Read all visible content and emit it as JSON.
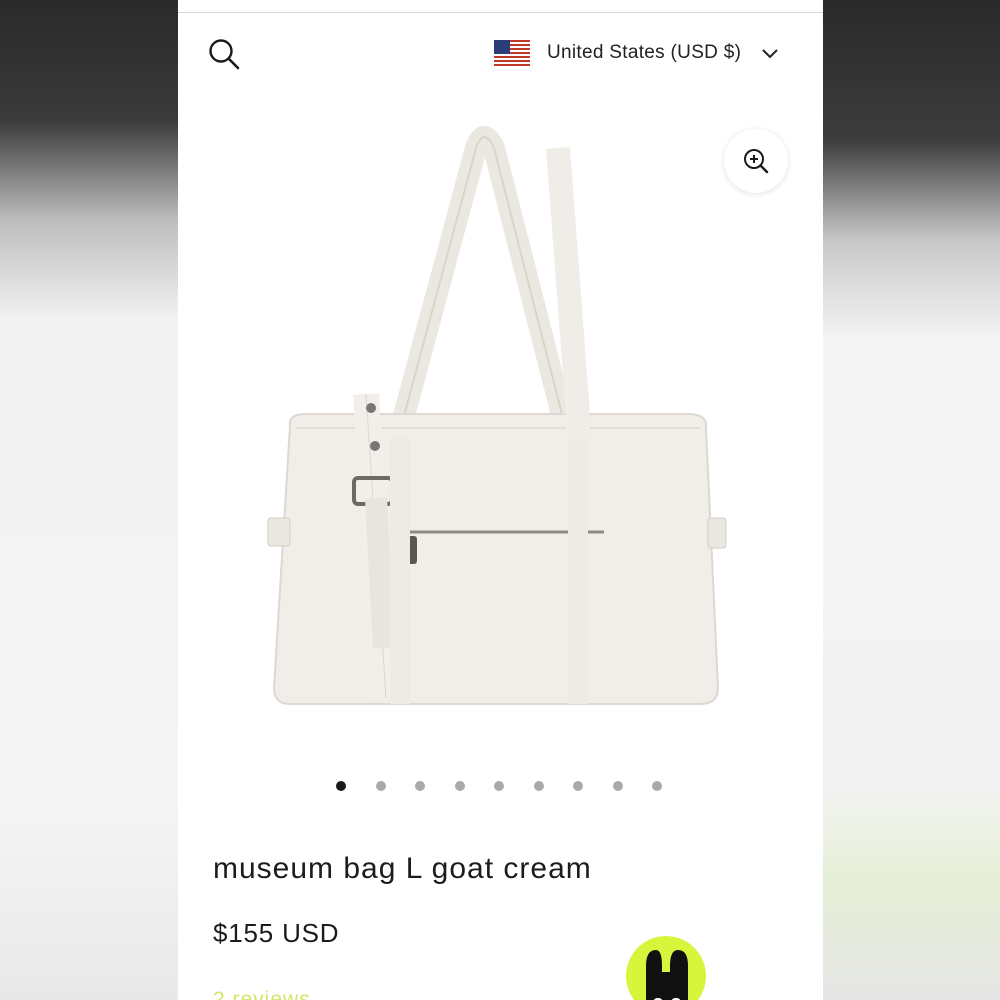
{
  "header": {
    "search_icon": "search-icon",
    "region_label": "United States (USD $)",
    "flag_icon": "us-flag-icon",
    "chevron_icon": "chevron-down-icon"
  },
  "gallery": {
    "zoom_icon": "zoom-in-icon",
    "image_count": 9,
    "active_index": 0
  },
  "product": {
    "title": "museum bag L goat cream",
    "price": "$155 USD",
    "reviews": "2 reviews"
  },
  "colors": {
    "accent": "#d7f53a",
    "text": "#1c1c1c",
    "dot_active": "#1a1a1a",
    "dot_inactive": "#a9a9a9"
  }
}
